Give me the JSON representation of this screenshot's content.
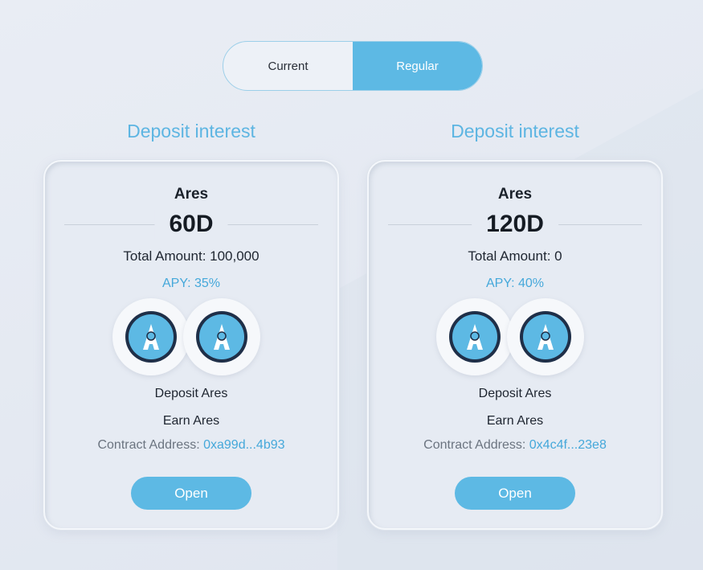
{
  "toggle": {
    "current_label": "Current",
    "regular_label": "Regular",
    "selected": "Regular"
  },
  "colors": {
    "accent": "#5db9e4",
    "accent_text": "#45a8da",
    "title": "#5db5e2",
    "background": "#e6ebf3"
  },
  "pools": [
    {
      "section_title": "Deposit interest",
      "token_name": "Ares",
      "period": "60D",
      "total_amount": "Total Amount: 100,000",
      "apy": "APY: 35%",
      "deposit_label": "Deposit Ares",
      "earn_label": "Earn Ares",
      "contract_label": "Contract Address:",
      "contract_address": "0xa99d...4b93",
      "open_label": "Open",
      "icons": [
        "ares-token-icon",
        "ares-token-icon"
      ]
    },
    {
      "section_title": "Deposit interest",
      "token_name": "Ares",
      "period": "120D",
      "total_amount": "Total Amount: 0",
      "apy": "APY: 40%",
      "deposit_label": "Deposit Ares",
      "earn_label": "Earn Ares",
      "contract_label": "Contract Address:",
      "contract_address": "0x4c4f...23e8",
      "open_label": "Open",
      "icons": [
        "ares-token-icon",
        "ares-token-icon"
      ]
    }
  ]
}
